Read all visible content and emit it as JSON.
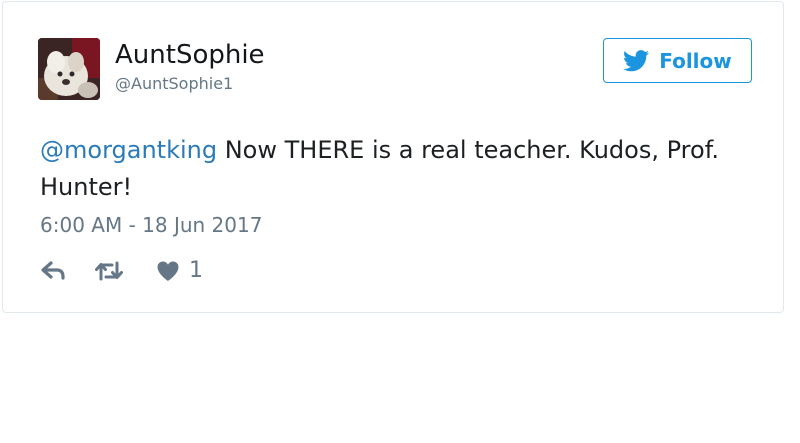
{
  "tweet": {
    "author": {
      "display_name": "AuntSophie",
      "handle": "@AuntSophie1"
    },
    "follow_label": "Follow",
    "text": {
      "mention": "@morgantking",
      "body": " Now THERE is a real teacher. Kudos, Prof. Hunter!"
    },
    "timestamp": "6:00 AM - 18 Jun 2017",
    "actions": {
      "like_count": "1"
    }
  },
  "colors": {
    "brand_blue": "#1b95e0",
    "link_blue": "#2b7bb9",
    "text": "#1c2022",
    "muted": "#657786",
    "border": "#e1e8ed"
  },
  "icons": [
    "twitter-bird-icon",
    "reply-icon",
    "retweet-icon",
    "heart-icon"
  ]
}
